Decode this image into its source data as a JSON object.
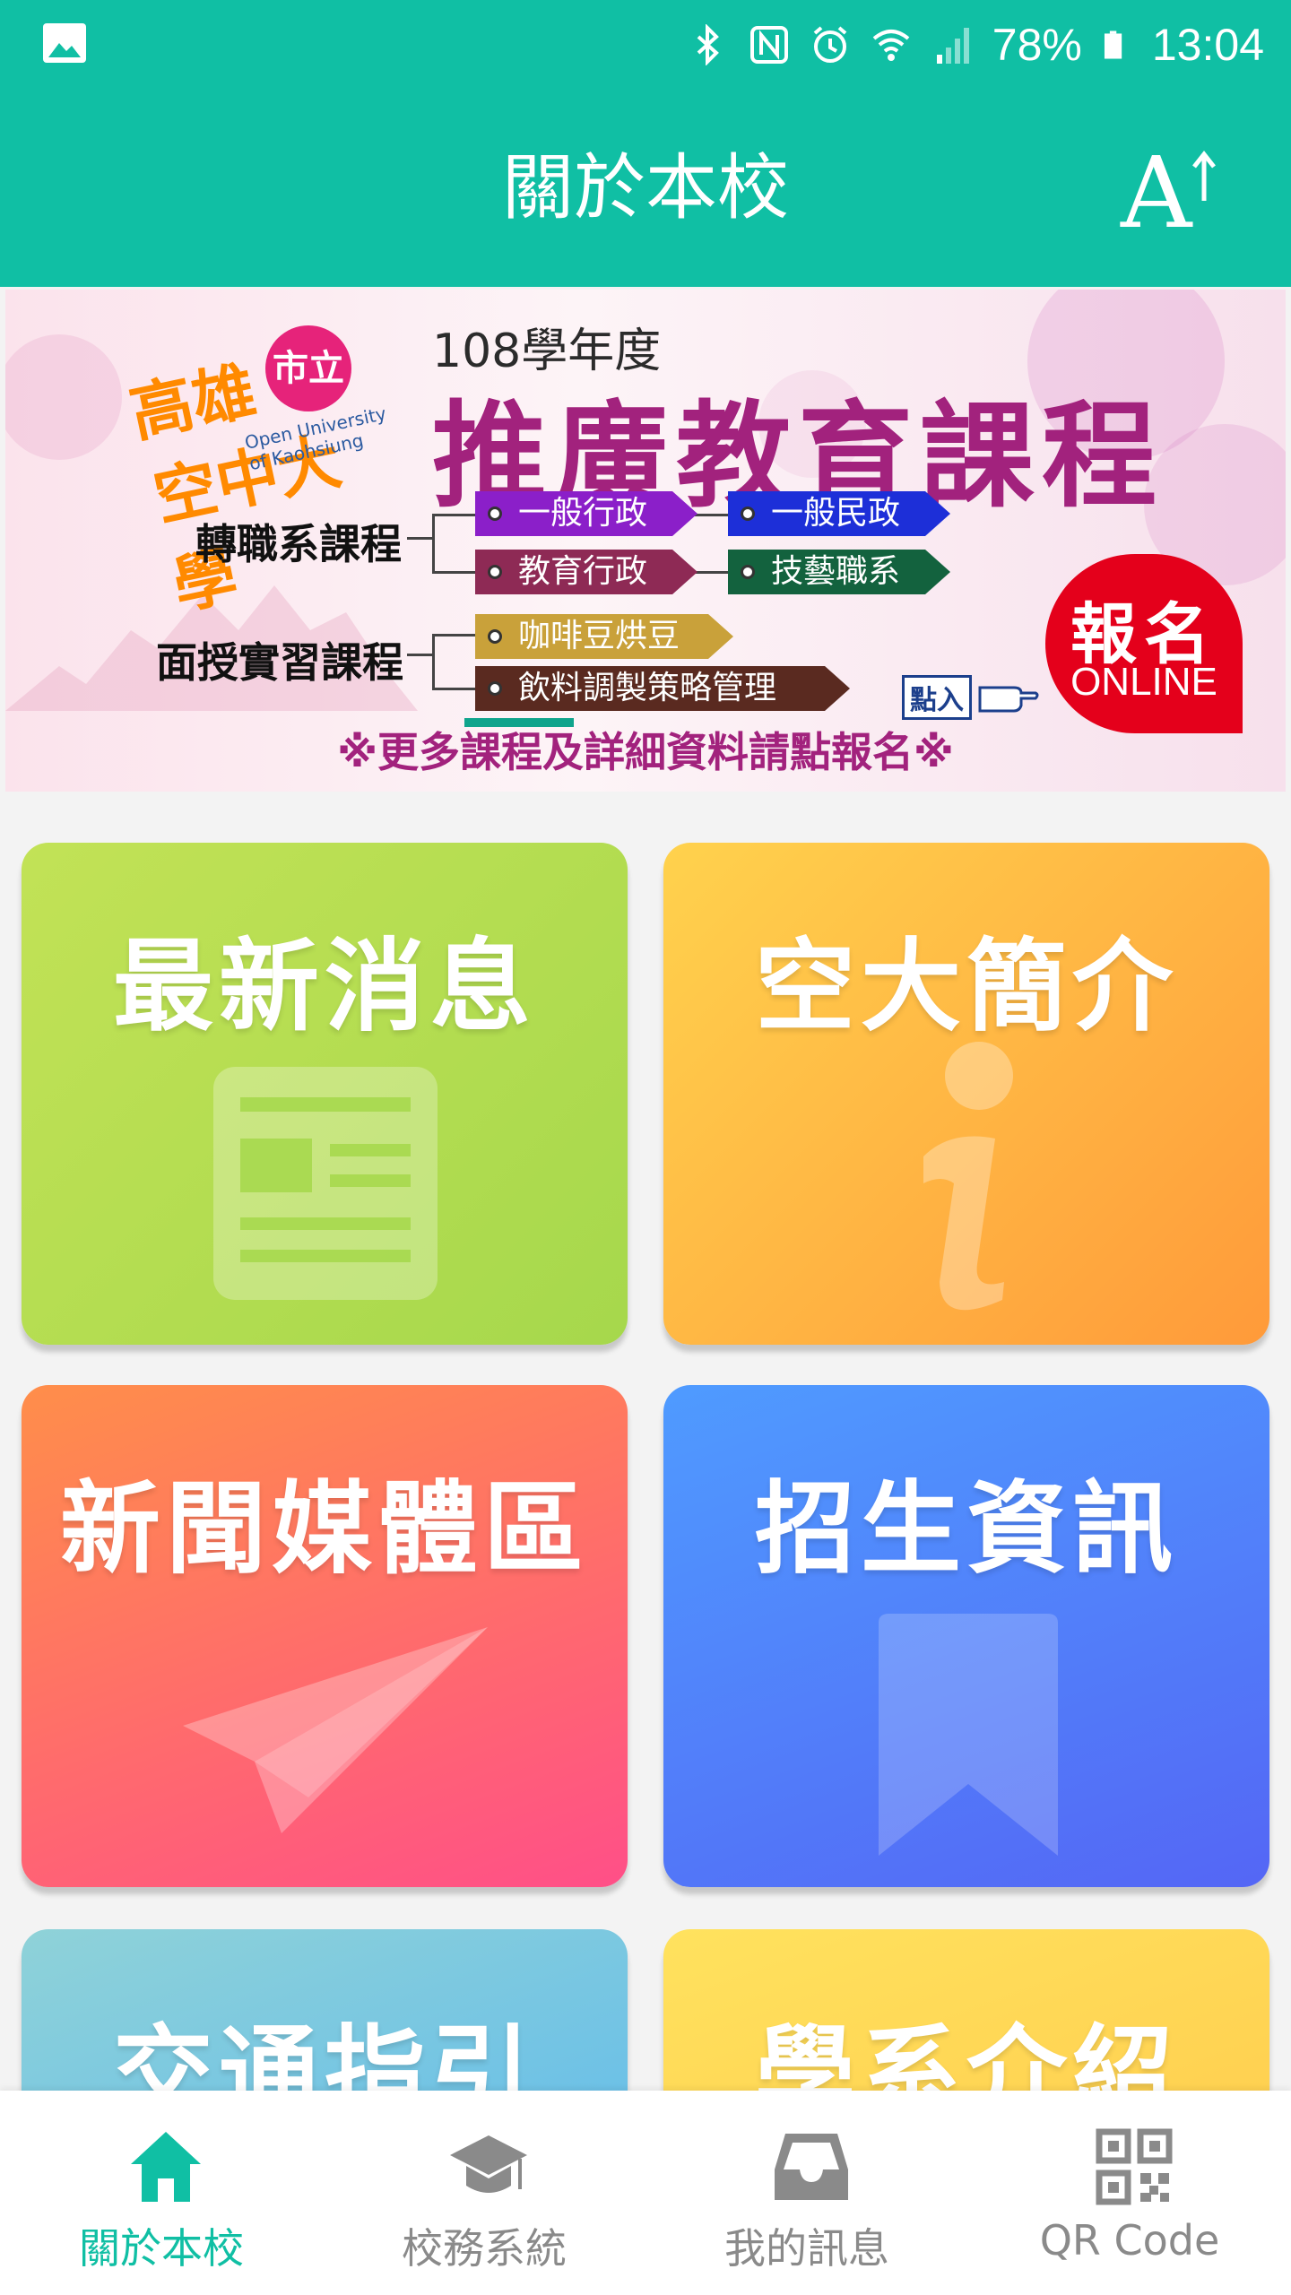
{
  "status_bar": {
    "battery": "78%",
    "time": "13:04"
  },
  "header": {
    "title": "關於本校",
    "font_size_button": "A"
  },
  "banner": {
    "logo_city": "市立",
    "logo_line1": "高雄",
    "logo_line2": "空中大學",
    "logo_en": "Open University of Kaohsiung",
    "year": "108學年度",
    "headline": "推廣教育課程",
    "category1": "轉職系課程",
    "category2": "面授實習課程",
    "tags": [
      "一般行政",
      "一般民政",
      "教育行政",
      "技藝職系",
      "咖啡豆烘豆",
      "飲料調製策略管理"
    ],
    "register_line1": "報名",
    "register_line2": "ONLINE",
    "click_hint": "點入",
    "footer": "※更多課程及詳細資料請點報名※"
  },
  "tiles": [
    {
      "label": "最新消息"
    },
    {
      "label": "空大簡介"
    },
    {
      "label": "新聞媒體區"
    },
    {
      "label": "招生資訊"
    },
    {
      "label": "交通指引"
    },
    {
      "label": "學系介紹"
    }
  ],
  "bottom_nav": [
    {
      "label": "關於本校",
      "icon": "home-icon",
      "active": true
    },
    {
      "label": "校務系統",
      "icon": "graduation-cap-icon",
      "active": false
    },
    {
      "label": "我的訊息",
      "icon": "inbox-icon",
      "active": false
    },
    {
      "label": "QR Code",
      "icon": "qr-code-icon",
      "active": false
    }
  ],
  "colors": {
    "primary": "#10bfa4",
    "nav_inactive": "#8a8a8a",
    "banner_headline": "#a2227d"
  }
}
